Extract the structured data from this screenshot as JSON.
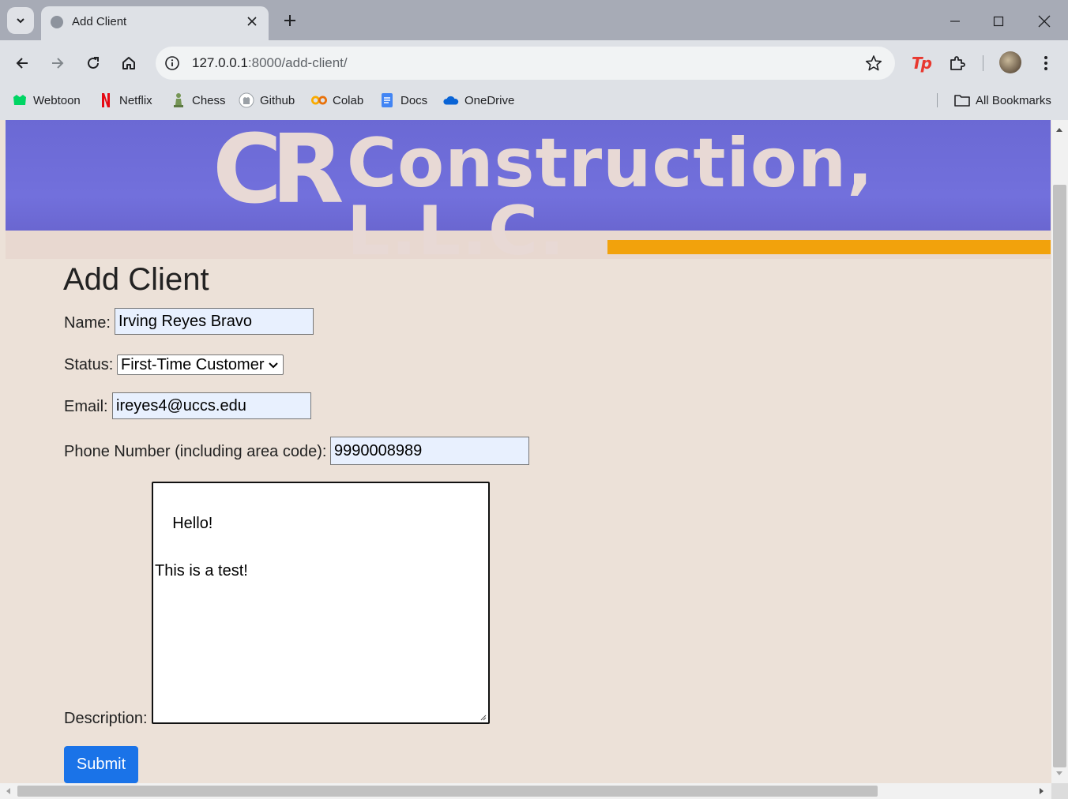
{
  "browser": {
    "tab_title": "Add Client",
    "url_host": "127.0.0.1",
    "url_path": ":8000/add-client/",
    "bookmarks": [
      {
        "label": "Webtoon",
        "icon": "webtoon-icon",
        "color": "#00d564"
      },
      {
        "label": "Netflix",
        "icon": "netflix-icon",
        "color": "#e50914"
      },
      {
        "label": "Chess",
        "icon": "chess-icon",
        "color": "#769656"
      },
      {
        "label": "Github",
        "icon": "github-icon",
        "color": "#6e7681"
      },
      {
        "label": "Colab",
        "icon": "colab-icon",
        "color": "#f9ab00"
      },
      {
        "label": "Docs",
        "icon": "docs-icon",
        "color": "#4285f4"
      },
      {
        "label": "OneDrive",
        "icon": "onedrive-icon",
        "color": "#0a64d6"
      }
    ],
    "all_bookmarks_label": "All Bookmarks"
  },
  "banner": {
    "logo_text": "CR",
    "company_name": "Construction, L.L.C."
  },
  "form": {
    "heading": "Add Client",
    "name_label": "Name:",
    "name_value": "Irving Reyes Bravo",
    "status_label": "Status:",
    "status_value": "First-Time Customer",
    "email_label": "Email:",
    "email_value": "ireyes4@uccs.edu",
    "phone_label": "Phone Number (including area code):",
    "phone_value": "9990008989",
    "description_label": "Description:",
    "description_value": "Hello!\n\nThis is a test!",
    "submit_label": "Submit"
  },
  "colors": {
    "page_background": "#ece1d8",
    "submit_button": "#1a73e8",
    "banner_blue": "#6e6cd8",
    "banner_orange": "#f2a20c"
  }
}
